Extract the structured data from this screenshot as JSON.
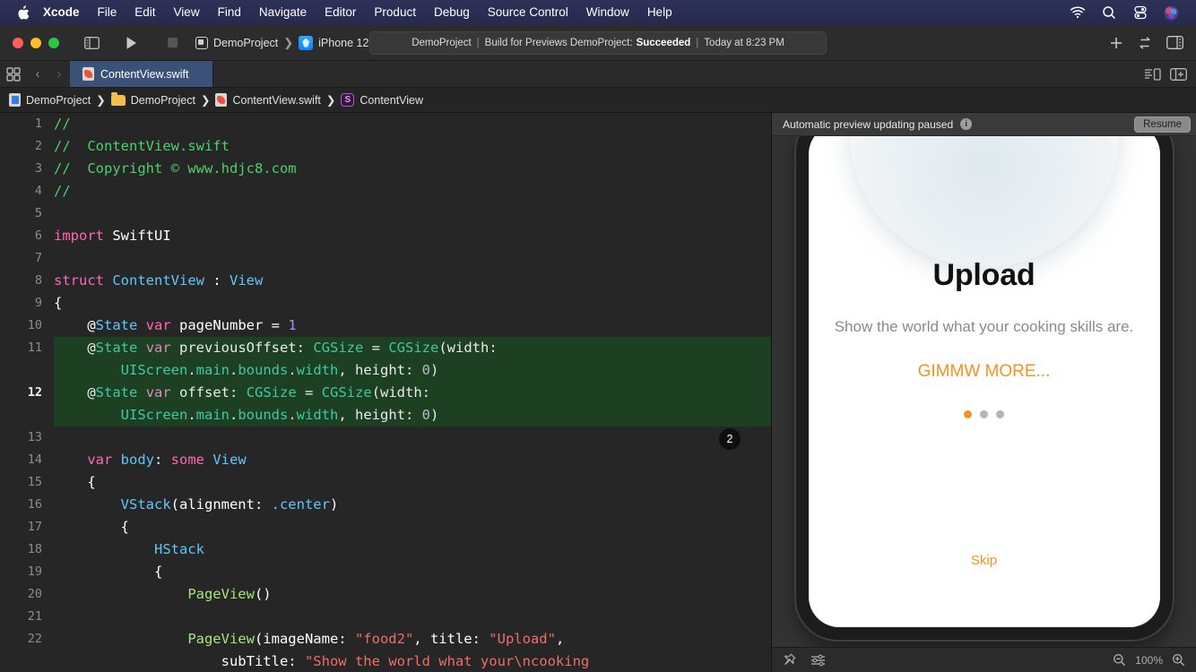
{
  "menubar": {
    "apple_icon": "apple-logo-icon",
    "items": [
      "Xcode",
      "File",
      "Edit",
      "View",
      "Find",
      "Navigate",
      "Editor",
      "Product",
      "Debug",
      "Source Control",
      "Window",
      "Help"
    ],
    "status_icons": [
      "wifi-icon",
      "search-icon",
      "control-center-icon",
      "siri-icon"
    ]
  },
  "toolbar": {
    "sidebar_toggle": "sidebar-toggle-icon",
    "run": "run-icon",
    "stop": "stop-icon",
    "scheme": "DemoProject",
    "destination": "iPhone 12",
    "status": {
      "project": "DemoProject",
      "action": "Build for Previews DemoProject:",
      "result": "Succeeded",
      "time": "Today at 8:23 PM"
    },
    "add_label": "+",
    "right_icons": [
      "add-icon",
      "code-review-icon",
      "inspector-toggle-icon"
    ]
  },
  "tabbar": {
    "grid_icon": "tab-grid-icon",
    "back": "‹",
    "forward": "›",
    "tab_label": "ContentView.swift",
    "right_icons": [
      "minimap-toggle-icon",
      "add-editor-icon"
    ]
  },
  "breadcrumb": {
    "items": [
      "DemoProject",
      "DemoProject",
      "ContentView.swift",
      "ContentView"
    ],
    "struct_glyph": "S"
  },
  "editor": {
    "current_line": 12,
    "change_badge": "2",
    "lines": [
      {
        "n": "1",
        "tokens": [
          {
            "t": "//",
            "c": "c-com"
          }
        ]
      },
      {
        "n": "2",
        "tokens": [
          {
            "t": "//  ContentView.swift",
            "c": "c-com"
          }
        ]
      },
      {
        "n": "3",
        "tokens": [
          {
            "t": "//  Copyright © www.hdjc8.com",
            "c": "c-com"
          }
        ]
      },
      {
        "n": "4",
        "tokens": [
          {
            "t": "//",
            "c": "c-com"
          }
        ]
      },
      {
        "n": "5",
        "tokens": []
      },
      {
        "n": "6",
        "tokens": [
          {
            "t": "import",
            "c": "c-kw"
          },
          {
            "t": " ",
            "c": "c-plain"
          },
          {
            "t": "SwiftUI",
            "c": "c-plain"
          }
        ]
      },
      {
        "n": "7",
        "tokens": []
      },
      {
        "n": "8",
        "tokens": [
          {
            "t": "struct",
            "c": "c-kw"
          },
          {
            "t": " ",
            "c": "c-plain"
          },
          {
            "t": "ContentView",
            "c": "c-type"
          },
          {
            "t": " : ",
            "c": "c-plain"
          },
          {
            "t": "View",
            "c": "c-type"
          }
        ]
      },
      {
        "n": "9",
        "tokens": [
          {
            "t": "{",
            "c": "c-plain"
          }
        ]
      },
      {
        "n": "10",
        "tokens": [
          {
            "t": "    @",
            "c": "c-plain"
          },
          {
            "t": "State",
            "c": "c-attr"
          },
          {
            "t": " ",
            "c": "c-plain"
          },
          {
            "t": "var",
            "c": "c-kw"
          },
          {
            "t": " pageNumber = ",
            "c": "c-plain"
          },
          {
            "t": "1",
            "c": "c-num"
          }
        ]
      },
      {
        "n": "11",
        "hl": true,
        "tokens": [
          {
            "t": "    @",
            "c": "c-plain"
          },
          {
            "t": "State",
            "c": "c-attr"
          },
          {
            "t": " ",
            "c": "c-plain"
          },
          {
            "t": "var",
            "c": "c-kw"
          },
          {
            "t": " previousOffset: ",
            "c": "c-plain"
          },
          {
            "t": "CGSize",
            "c": "c-type"
          },
          {
            "t": " = ",
            "c": "c-plain"
          },
          {
            "t": "CGSize",
            "c": "c-type"
          },
          {
            "t": "(width:\n        ",
            "c": "c-plain"
          },
          {
            "t": "UIScreen",
            "c": "c-type"
          },
          {
            "t": ".",
            "c": "c-plain"
          },
          {
            "t": "main",
            "c": "c-prop"
          },
          {
            "t": ".",
            "c": "c-plain"
          },
          {
            "t": "bounds",
            "c": "c-prop"
          },
          {
            "t": ".",
            "c": "c-plain"
          },
          {
            "t": "width",
            "c": "c-prop"
          },
          {
            "t": ", height: ",
            "c": "c-plain"
          },
          {
            "t": "0",
            "c": "c-num"
          },
          {
            "t": ")",
            "c": "c-plain"
          }
        ]
      },
      {
        "n": "12",
        "hl": true,
        "cur": true,
        "tokens": [
          {
            "t": "    @",
            "c": "c-plain"
          },
          {
            "t": "State",
            "c": "c-attr"
          },
          {
            "t": " ",
            "c": "c-plain"
          },
          {
            "t": "var",
            "c": "c-kw"
          },
          {
            "t": " offset: ",
            "c": "c-plain"
          },
          {
            "t": "CGSize",
            "c": "c-type"
          },
          {
            "t": " = ",
            "c": "c-plain"
          },
          {
            "t": "CGSize",
            "c": "c-type"
          },
          {
            "t": "(width:\n        ",
            "c": "c-plain"
          },
          {
            "t": "UIScreen",
            "c": "c-type"
          },
          {
            "t": ".",
            "c": "c-plain"
          },
          {
            "t": "main",
            "c": "c-prop"
          },
          {
            "t": ".",
            "c": "c-plain"
          },
          {
            "t": "bounds",
            "c": "c-prop"
          },
          {
            "t": ".",
            "c": "c-plain"
          },
          {
            "t": "width",
            "c": "c-prop"
          },
          {
            "t": ", height: ",
            "c": "c-plain"
          },
          {
            "t": "0",
            "c": "c-num"
          },
          {
            "t": ")",
            "c": "c-plain"
          }
        ]
      },
      {
        "n": "13",
        "tokens": []
      },
      {
        "n": "14",
        "tokens": [
          {
            "t": "    ",
            "c": "c-plain"
          },
          {
            "t": "var",
            "c": "c-kw"
          },
          {
            "t": " ",
            "c": "c-plain"
          },
          {
            "t": "body",
            "c": "c-type"
          },
          {
            "t": ": ",
            "c": "c-plain"
          },
          {
            "t": "some",
            "c": "c-kw"
          },
          {
            "t": " ",
            "c": "c-plain"
          },
          {
            "t": "View",
            "c": "c-type"
          }
        ]
      },
      {
        "n": "15",
        "tokens": [
          {
            "t": "    {",
            "c": "c-plain"
          }
        ]
      },
      {
        "n": "16",
        "tokens": [
          {
            "t": "        ",
            "c": "c-plain"
          },
          {
            "t": "VStack",
            "c": "c-type"
          },
          {
            "t": "(alignment: ",
            "c": "c-plain"
          },
          {
            "t": ".center",
            "c": "c-type"
          },
          {
            "t": ")",
            "c": "c-plain"
          }
        ]
      },
      {
        "n": "17",
        "tokens": [
          {
            "t": "        {",
            "c": "c-plain"
          }
        ]
      },
      {
        "n": "18",
        "tokens": [
          {
            "t": "            ",
            "c": "c-plain"
          },
          {
            "t": "HStack",
            "c": "c-type"
          }
        ]
      },
      {
        "n": "19",
        "tokens": [
          {
            "t": "            {",
            "c": "c-plain"
          }
        ]
      },
      {
        "n": "20",
        "tokens": [
          {
            "t": "                ",
            "c": "c-plain"
          },
          {
            "t": "PageView",
            "c": "c-custom"
          },
          {
            "t": "()",
            "c": "c-plain"
          }
        ]
      },
      {
        "n": "21",
        "tokens": []
      },
      {
        "n": "22",
        "tokens": [
          {
            "t": "                ",
            "c": "c-plain"
          },
          {
            "t": "PageView",
            "c": "c-custom"
          },
          {
            "t": "(imageName: ",
            "c": "c-plain"
          },
          {
            "t": "\"food2\"",
            "c": "c-str"
          },
          {
            "t": ", title: ",
            "c": "c-plain"
          },
          {
            "t": "\"Upload\"",
            "c": "c-str"
          },
          {
            "t": ",\n                    subTitle: ",
            "c": "c-plain"
          },
          {
            "t": "\"Show the world what your\\ncooking",
            "c": "c-str"
          }
        ]
      }
    ]
  },
  "preview": {
    "header_text": "Automatic preview updating paused",
    "info_icon": "info-icon",
    "resume_label": "Resume",
    "device": {
      "title": "Upload",
      "subtitle": "Show the world what your cooking skills are.",
      "cta": "GIMMW MORE...",
      "skip": "Skip",
      "page_dots": 3,
      "active_dot": 0,
      "accent_color": "#f6921e"
    },
    "footer": {
      "pin_icon": "pin-icon",
      "variants_icon": "preview-variants-icon",
      "zoom_out_icon": "zoom-out-icon",
      "zoom_level": "100%",
      "zoom_in_icon": "zoom-in-icon"
    }
  }
}
